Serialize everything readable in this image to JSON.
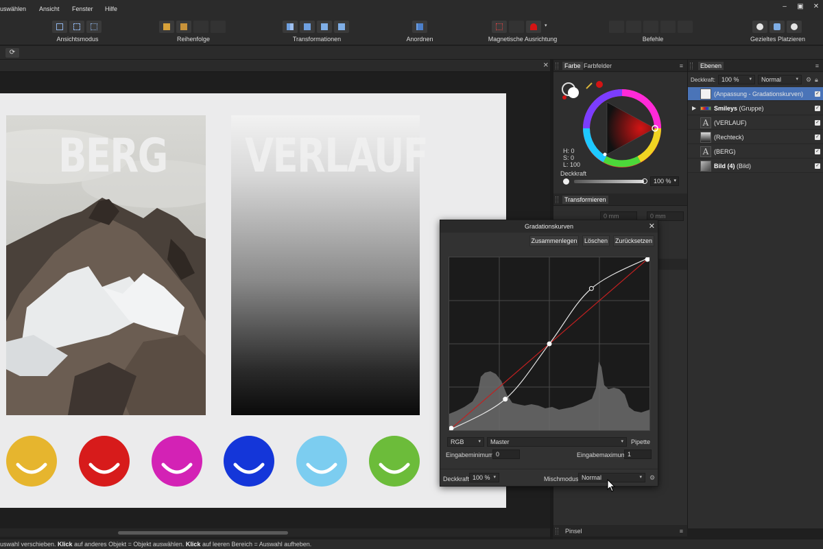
{
  "menu": {
    "items": [
      "uswählen",
      "Ansicht",
      "Fenster",
      "Hilfe"
    ]
  },
  "toolbar": {
    "groups": [
      {
        "label": "Ansichtsmodus"
      },
      {
        "label": "Reihenfolge"
      },
      {
        "label": "Transformationen"
      },
      {
        "label": "Anordnen"
      },
      {
        "label": "Magnetische Ausrichtung"
      },
      {
        "label": "Befehle"
      },
      {
        "label": "Gezieltes Platzieren"
      }
    ]
  },
  "canvas": {
    "title_left": "BERG",
    "title_right": "VERLAUF",
    "smiley_colors": [
      "#e6b52e",
      "#d71b1b",
      "#d322b5",
      "#1436d9",
      "#7ccdf0",
      "#6cbc3a"
    ]
  },
  "color_panel": {
    "tab_color": "Farbe",
    "tab_swatches": "Farbfelder",
    "hsl_h": "H: 0",
    "hsl_s": "S: 0",
    "hsl_l": "L: 100",
    "opacity_label": "Deckkraft",
    "opacity_value": "100 %",
    "transform_tab": "Transformieren",
    "transform_x": "0 mm",
    "transform_y": "0 mm",
    "brush_tab": "Pinsel"
  },
  "layers_panel": {
    "tab": "Ebenen",
    "opacity_label": "Deckkraft:",
    "opacity_value": "100 %",
    "blend_mode": "Normal",
    "layers": [
      {
        "name": "(Anpassung - Gradationskurven)",
        "bold": "",
        "selected": true,
        "icon": "curves-thumb"
      },
      {
        "name": " (Gruppe)",
        "bold": "Smileys",
        "selected": false,
        "icon": "group-thumb"
      },
      {
        "name": "(VERLAUF)",
        "bold": "",
        "selected": false,
        "icon": "text-thumb"
      },
      {
        "name": "(Rechteck)",
        "bold": "",
        "selected": false,
        "icon": "rect-thumb"
      },
      {
        "name": "(BERG)",
        "bold": "",
        "selected": false,
        "icon": "text-thumb"
      },
      {
        "name": " (Bild)",
        "bold": "Bild (4)",
        "selected": false,
        "icon": "image-thumb"
      }
    ]
  },
  "curves_dialog": {
    "title": "Gradationskurven",
    "merge_label": "Zusammenlegen",
    "delete_label": "Löschen",
    "reset_label": "Zurücksetzen",
    "color_space": "RGB",
    "channel": "Master",
    "picker_label": "Pipette",
    "input_min_label": "Eingabeminimum:",
    "input_min_value": "0",
    "input_max_label": "Eingabemaximum:",
    "input_max_value": "1",
    "opacity_label": "Deckkraft:",
    "opacity_value": "100 %",
    "blend_label": "Mischmodus:",
    "blend_value": "Normal",
    "curve_points": [
      [
        0,
        0
      ],
      [
        0.28,
        0.18
      ],
      [
        0.5,
        0.5
      ],
      [
        0.71,
        0.82
      ],
      [
        1,
        1
      ]
    ]
  },
  "status": {
    "part1": "uswahl verschieben. ",
    "bold1": "Klick",
    "part2": " auf anderes Objekt = Objekt auswählen. ",
    "bold2": "Klick",
    "part3": " auf leeren Bereich = Auswahl aufheben."
  },
  "colors": {
    "selection": "#4a74b8",
    "accent_red": "#d41414"
  }
}
